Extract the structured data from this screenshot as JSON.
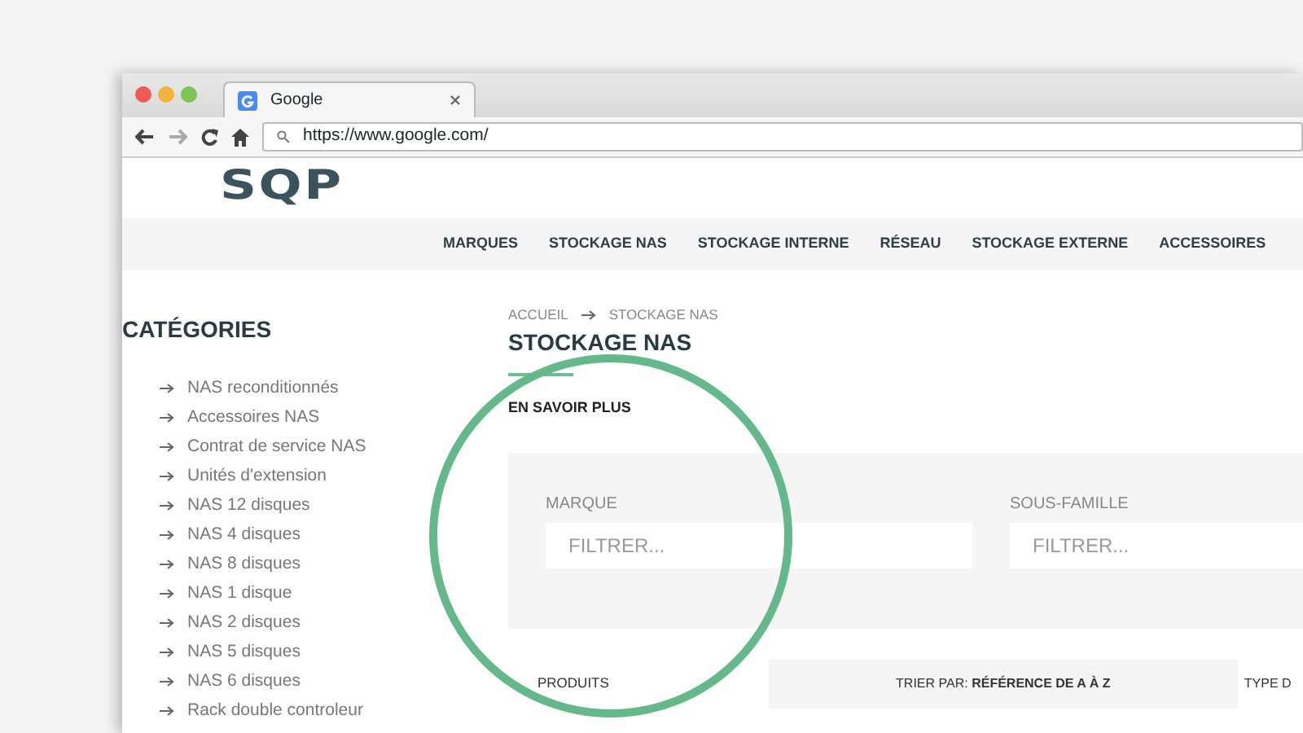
{
  "browser": {
    "tab_title": "Google",
    "address": "https://www.google.com/"
  },
  "logo": "SQP",
  "nav": [
    "MARQUES",
    "STOCKAGE NAS",
    "STOCKAGE INTERNE",
    "RÉSEAU",
    "STOCKAGE EXTERNE",
    "ACCESSOIRES"
  ],
  "sidebar": {
    "title": "CATÉGORIES",
    "items": [
      "NAS reconditionnés",
      "Accessoires NAS",
      "Contrat de service NAS",
      "Unités d'extension",
      "NAS 12 disques",
      "NAS 4 disques",
      "NAS 8 disques",
      "NAS 1 disque",
      "NAS 2 disques",
      "NAS 5 disques",
      "NAS 6 disques",
      "Rack double controleur"
    ]
  },
  "breadcrumb": [
    "ACCUEIL",
    "STOCKAGE NAS"
  ],
  "title": "STOCKAGE NAS",
  "more_link": "EN SAVOIR PLUS",
  "filters": [
    {
      "label": "MARQUE",
      "placeholder": "FILTRER..."
    },
    {
      "label": "SOUS-FAMILLE",
      "placeholder": "FILTRER..."
    }
  ],
  "results": {
    "count_label": "PRODUITS",
    "sort": "TRIER PAR: **RÉFÉRENCE DE A À Z**",
    "column_3": "TYPE D"
  }
}
